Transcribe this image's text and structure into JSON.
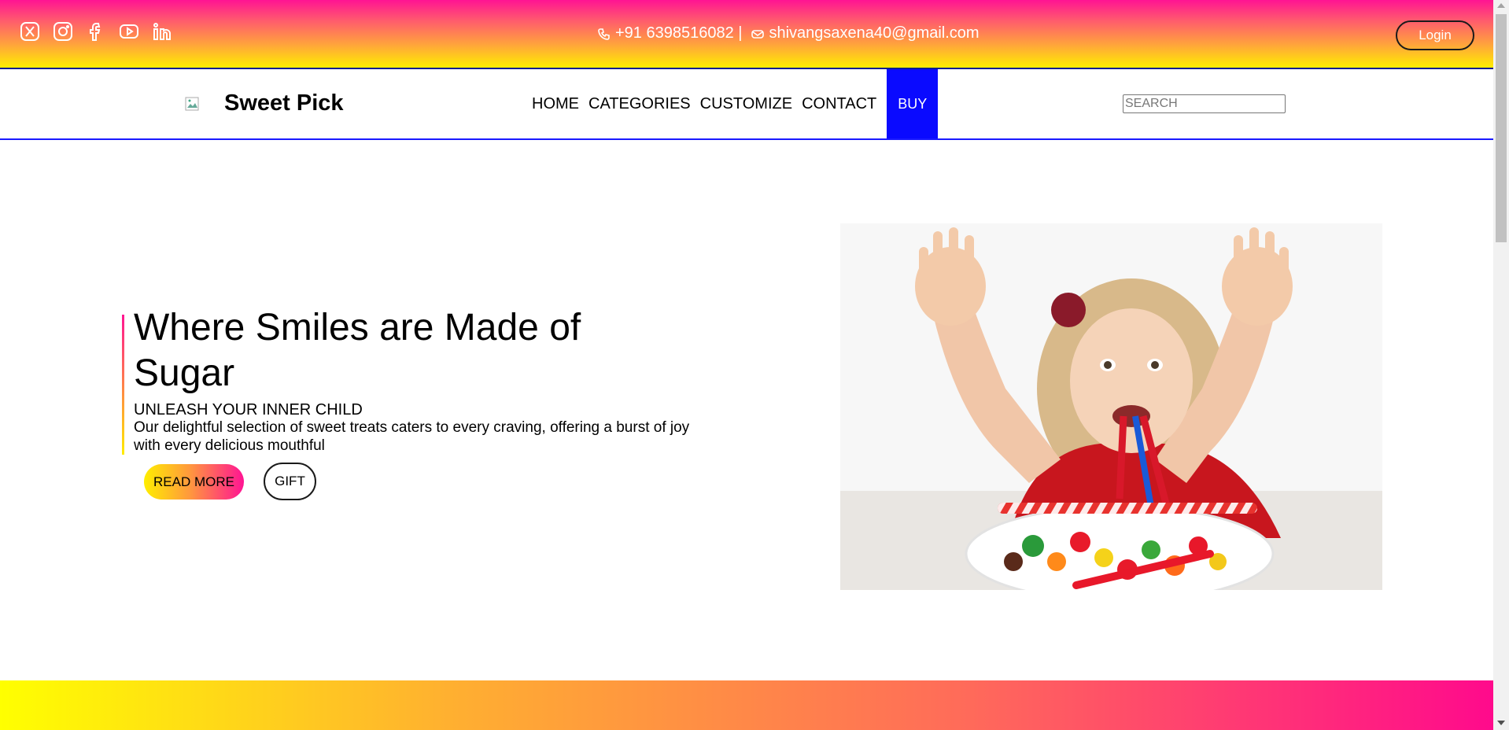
{
  "topbar": {
    "social_icons": [
      "x-icon",
      "instagram-icon",
      "facebook-icon",
      "youtube-icon",
      "linkedin-icon"
    ],
    "phone": "+91 6398516082 |",
    "email": "shivangsaxena40@gmail.com",
    "login_label": "Login"
  },
  "nav": {
    "brand": "Sweet Pick",
    "items": [
      "HOME",
      "CATEGORIES",
      "CUSTOMIZE",
      "CONTACT"
    ],
    "buy_label": "BUY",
    "search_placeholder": "SEARCH"
  },
  "hero": {
    "title": "Where Smiles are Made of Sugar",
    "subtitle": "UNLEASH YOUR INNER CHILD",
    "description": "Our delightful selection of sweet treats caters to every craving, offering a burst of joy with every delicious mouthful",
    "read_more_label": "READ MORE",
    "gift_label": "GIFT"
  },
  "colors": {
    "gradient_pink": "#ff1493",
    "gradient_yellow": "#ffee00",
    "buy_blue": "#0a0aff",
    "nav_border": "#1a1aff"
  }
}
